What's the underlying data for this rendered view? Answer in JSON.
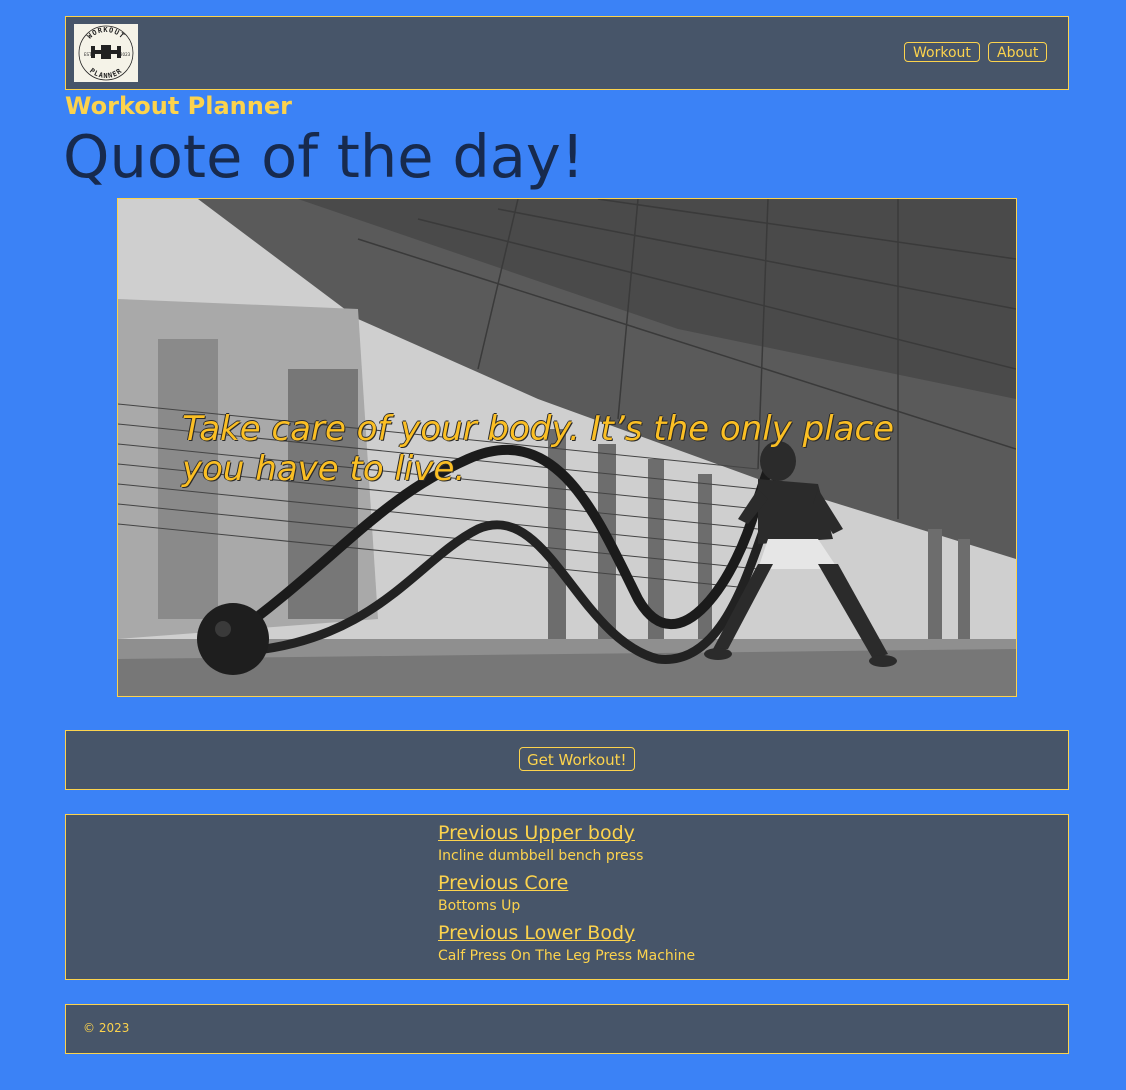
{
  "nav": {
    "logo_top_text": "WORKOUT",
    "logo_bottom_text": "PLANNER",
    "logo_est": "EST",
    "logo_year": "2023",
    "items": [
      {
        "label": "Workout"
      },
      {
        "label": "About"
      }
    ]
  },
  "brand": "Workout Planner",
  "headline": "Quote of the day!",
  "hero": {
    "quote": "Take care of your body. It’s the only place you have to live."
  },
  "action": {
    "get_workout_label": "Get Workout!"
  },
  "history": [
    {
      "title": "Previous Upper body",
      "exercise": "Incline dumbbell bench press"
    },
    {
      "title": "Previous Core",
      "exercise": "Bottoms Up"
    },
    {
      "title": "Previous Lower Body",
      "exercise": "Calf Press On The Leg Press Machine"
    }
  ],
  "footer": {
    "copyright": "© 2023"
  },
  "colors": {
    "background": "#3b82f6",
    "panel": "#475569",
    "accent": "#fcd34d",
    "headline": "#172a4e"
  }
}
